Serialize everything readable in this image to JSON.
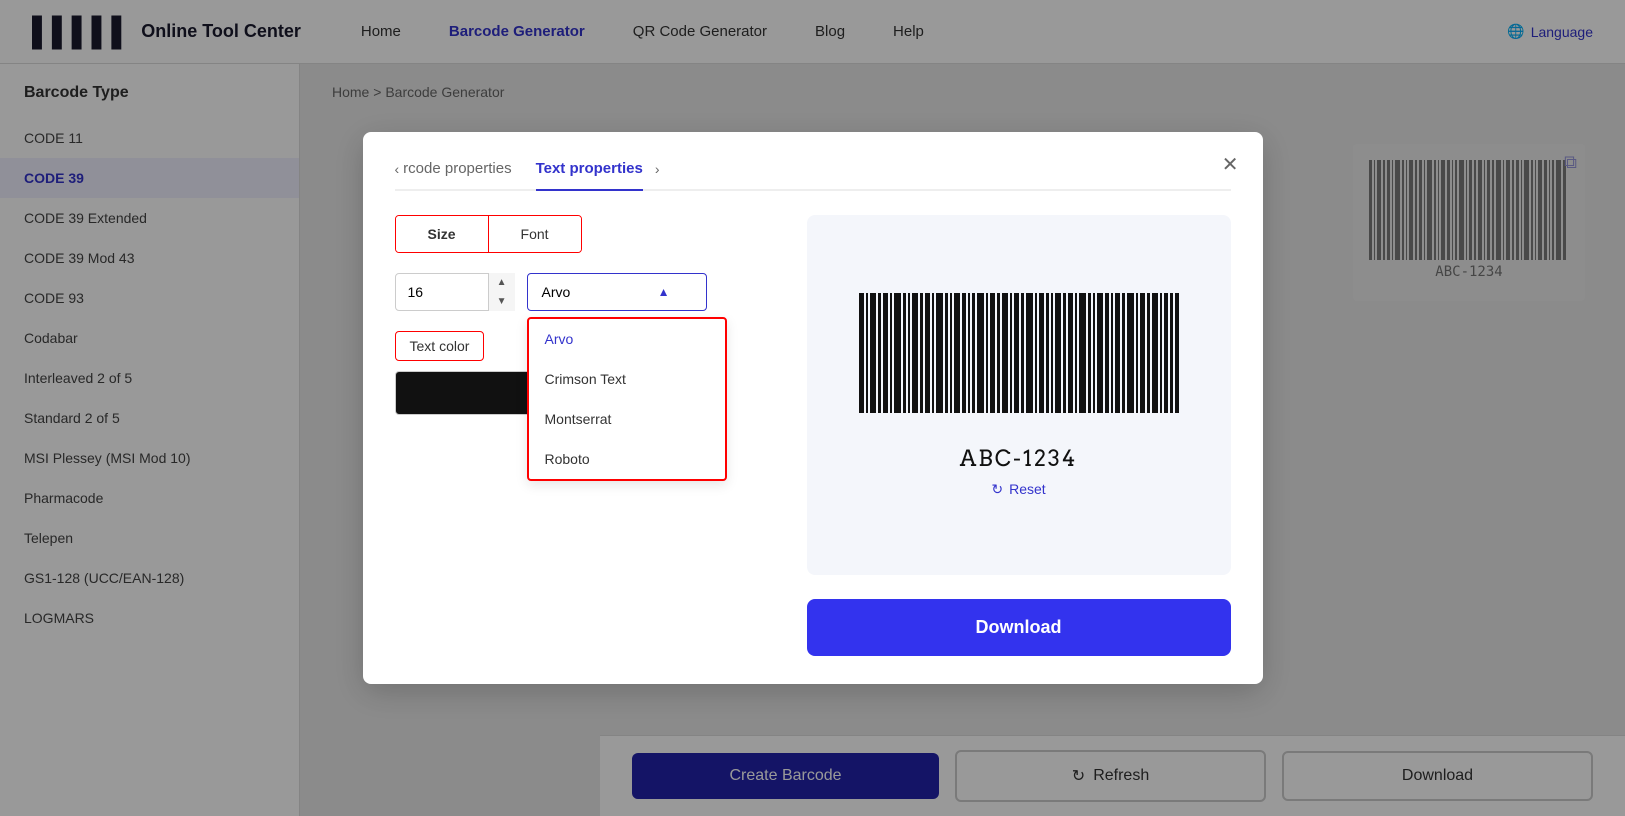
{
  "header": {
    "logo_text": "Online Tool Center",
    "nav": [
      {
        "label": "Home",
        "active": false
      },
      {
        "label": "Barcode Generator",
        "active": true
      },
      {
        "label": "QR Code Generator",
        "active": false
      },
      {
        "label": "Blog",
        "active": false
      },
      {
        "label": "Help",
        "active": false
      }
    ],
    "language_label": "Language"
  },
  "sidebar": {
    "title": "Barcode Type",
    "items": [
      {
        "label": "CODE 11",
        "active": false
      },
      {
        "label": "CODE 39",
        "active": true
      },
      {
        "label": "CODE 39 Extended",
        "active": false
      },
      {
        "label": "CODE 39 Mod 43",
        "active": false
      },
      {
        "label": "CODE 93",
        "active": false
      },
      {
        "label": "Codabar",
        "active": false
      },
      {
        "label": "Interleaved 2 of 5",
        "active": false
      },
      {
        "label": "Standard 2 of 5",
        "active": false
      },
      {
        "label": "MSI Plessey (MSI Mod 10)",
        "active": false
      },
      {
        "label": "Pharmacode",
        "active": false
      },
      {
        "label": "Telepen",
        "active": false
      },
      {
        "label": "GS1-128 (UCC/EAN-128)",
        "active": false
      },
      {
        "label": "LOGMARS",
        "active": false
      }
    ]
  },
  "breadcrumb": {
    "home": "Home",
    "separator": ">",
    "current": "Barcode Generator"
  },
  "bottom_bar": {
    "create_label": "Create Barcode",
    "refresh_label": "Refresh",
    "download_label": "Download"
  },
  "modal": {
    "prev_tab_label": "rcode properties",
    "active_tab_label": "Text properties",
    "close_title": "Close",
    "prop_tabs": {
      "size_label": "Size",
      "font_label": "Font"
    },
    "size_value": "16",
    "font_selected": "Arvo",
    "font_options": [
      "Arvo",
      "Crimson Text",
      "Montserrat",
      "Roboto"
    ],
    "text_color_label": "Text color",
    "color_value": "#111111",
    "reset_label": "Reset",
    "download_label": "Download",
    "barcode_text": "ABC-1234"
  }
}
